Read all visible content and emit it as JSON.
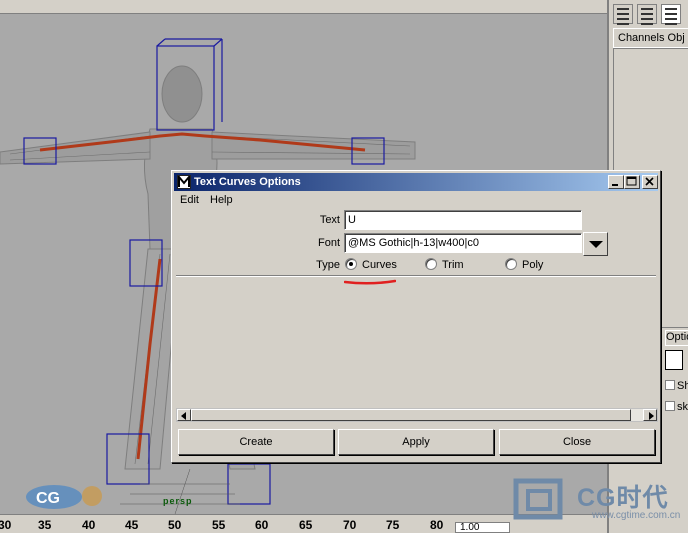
{
  "right_panel": {
    "channels_tab": "Channels Obj",
    "option_tab": "Option",
    "checkbox_labels": [
      "Sh",
      "sk"
    ]
  },
  "time_ruler": {
    "ticks": [
      "30",
      "35",
      "40",
      "45",
      "50",
      "55",
      "60",
      "65",
      "70",
      "75",
      "80"
    ],
    "current_time": "1.00"
  },
  "watermark": {
    "brand": "CG时代",
    "url": "www.cgtime.com.cn",
    "left_logo": "CG"
  },
  "viewport": {
    "persp_label": "persp"
  },
  "dialog": {
    "title": "Text Curves Options",
    "menu": [
      "Edit",
      "Help"
    ],
    "text_label": "Text",
    "text_value": "U",
    "font_label": "Font",
    "font_value": "@MS Gothic|h-13|w400|c0",
    "type_label": "Type",
    "type_options": [
      "Curves",
      "Trim",
      "Poly"
    ],
    "type_selected": "Curves",
    "buttons": {
      "create": "Create",
      "apply": "Apply",
      "close": "Close"
    },
    "annotation_color": "#e02020"
  },
  "colors": {
    "title_bar_start": "#0a246a",
    "title_bar_end": "#a6caf0",
    "viewport_bg": "#a9a9a9",
    "bounding_box": "#1a1aa0",
    "joint": "#b03a1a"
  }
}
